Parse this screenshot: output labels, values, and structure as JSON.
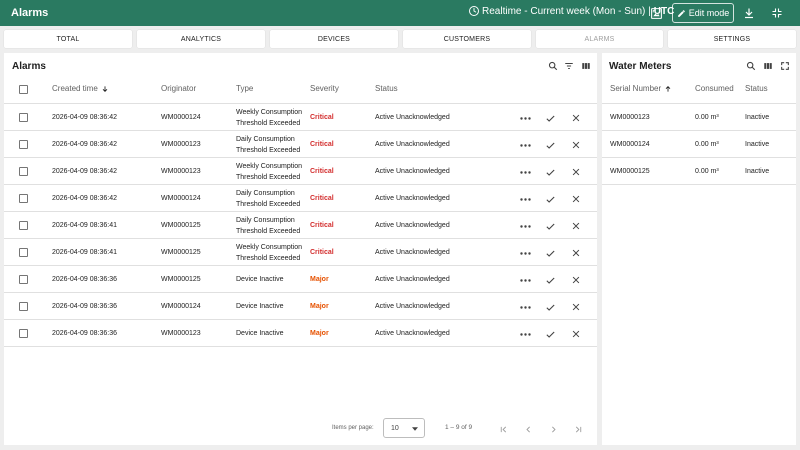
{
  "app": {
    "title": "Alarms",
    "timewindow_label": "Realtime - Current week (Mon - Sun) |",
    "timezone": "UTC",
    "edit_mode_label": "Edit mode",
    "brand_color": "#2a7a61"
  },
  "tabs": [
    {
      "label": "TOTAL",
      "disabled": false
    },
    {
      "label": "ANALYTICS",
      "disabled": false
    },
    {
      "label": "DEVICES",
      "disabled": false
    },
    {
      "label": "CUSTOMERS",
      "disabled": false
    },
    {
      "label": "ALARMS",
      "disabled": true
    },
    {
      "label": "SETTINGS",
      "disabled": false
    }
  ],
  "alarms": {
    "title": "Alarms",
    "columns": {
      "created": "Created time",
      "originator": "Originator",
      "type": "Type",
      "severity": "Severity",
      "status": "Status"
    },
    "rows": [
      {
        "created": "2026-04-09 08:36:42",
        "originator": "WM0000124",
        "type": "Weekly Consumption Threshold Exceeded",
        "severity": "Critical",
        "status": "Active Unacknowledged"
      },
      {
        "created": "2026-04-09 08:36:42",
        "originator": "WM0000123",
        "type": "Daily Consumption Threshold Exceeded",
        "severity": "Critical",
        "status": "Active Unacknowledged"
      },
      {
        "created": "2026-04-09 08:36:42",
        "originator": "WM0000123",
        "type": "Weekly Consumption Threshold Exceeded",
        "severity": "Critical",
        "status": "Active Unacknowledged"
      },
      {
        "created": "2026-04-09 08:36:42",
        "originator": "WM0000124",
        "type": "Daily Consumption Threshold Exceeded",
        "severity": "Critical",
        "status": "Active Unacknowledged"
      },
      {
        "created": "2026-04-09 08:36:41",
        "originator": "WM0000125",
        "type": "Daily Consumption Threshold Exceeded",
        "severity": "Critical",
        "status": "Active Unacknowledged"
      },
      {
        "created": "2026-04-09 08:36:41",
        "originator": "WM0000125",
        "type": "Weekly Consumption Threshold Exceeded",
        "severity": "Critical",
        "status": "Active Unacknowledged"
      },
      {
        "created": "2026-04-09 08:36:36",
        "originator": "WM0000125",
        "type": "Device Inactive",
        "severity": "Major",
        "status": "Active Unacknowledged"
      },
      {
        "created": "2026-04-09 08:36:36",
        "originator": "WM0000124",
        "type": "Device Inactive",
        "severity": "Major",
        "status": "Active Unacknowledged"
      },
      {
        "created": "2026-04-09 08:36:36",
        "originator": "WM0000123",
        "type": "Device Inactive",
        "severity": "Major",
        "status": "Active Unacknowledged"
      }
    ],
    "severity_colors": {
      "Critical": "#d32f2f",
      "Major": "#e65100"
    },
    "pagination": {
      "items_per_page_label": "Items per page:",
      "page_size": "10",
      "range": "1 – 9 of 9"
    }
  },
  "water_meters": {
    "title": "Water Meters",
    "columns": {
      "serial": "Serial Number",
      "consumed": "Consumed",
      "status": "Status"
    },
    "rows": [
      {
        "serial": "WM0000123",
        "consumed": "0.00 m³",
        "status": "Inactive"
      },
      {
        "serial": "WM0000124",
        "consumed": "0.00 m³",
        "status": "Inactive"
      },
      {
        "serial": "WM0000125",
        "consumed": "0.00 m³",
        "status": "Inactive"
      }
    ]
  }
}
